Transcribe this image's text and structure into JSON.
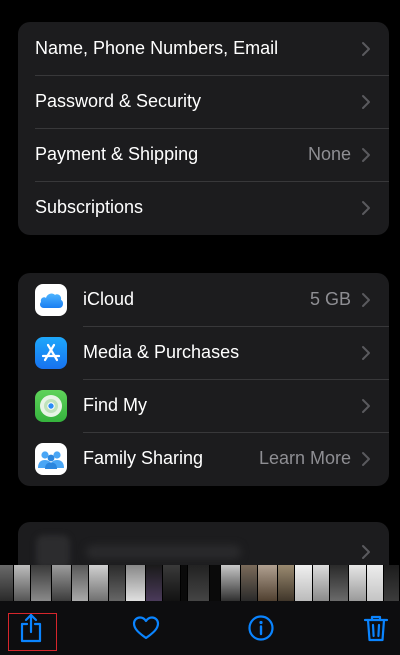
{
  "account_section": {
    "items": [
      {
        "label": "Name, Phone Numbers, Email",
        "value": ""
      },
      {
        "label": "Password & Security",
        "value": ""
      },
      {
        "label": "Payment & Shipping",
        "value": "None"
      },
      {
        "label": "Subscriptions",
        "value": ""
      }
    ]
  },
  "services_section": {
    "items": [
      {
        "label": "iCloud",
        "value": "5 GB",
        "icon": "icloud-icon"
      },
      {
        "label": "Media & Purchases",
        "value": "",
        "icon": "app-store-icon"
      },
      {
        "label": "Find My",
        "value": "",
        "icon": "find-my-icon"
      },
      {
        "label": "Family Sharing",
        "value": "Learn More",
        "icon": "family-sharing-icon"
      }
    ]
  },
  "toolbar": {
    "buttons": [
      "share-icon",
      "favorite-heart-icon",
      "info-icon",
      "trash-icon"
    ],
    "highlighted": "share-icon"
  },
  "colors": {
    "background": "#000000",
    "group_background": "#1c1c1e",
    "accent": "#0a84ff",
    "secondary_text": "#8e8e93",
    "highlight_border": "#d6262c"
  }
}
